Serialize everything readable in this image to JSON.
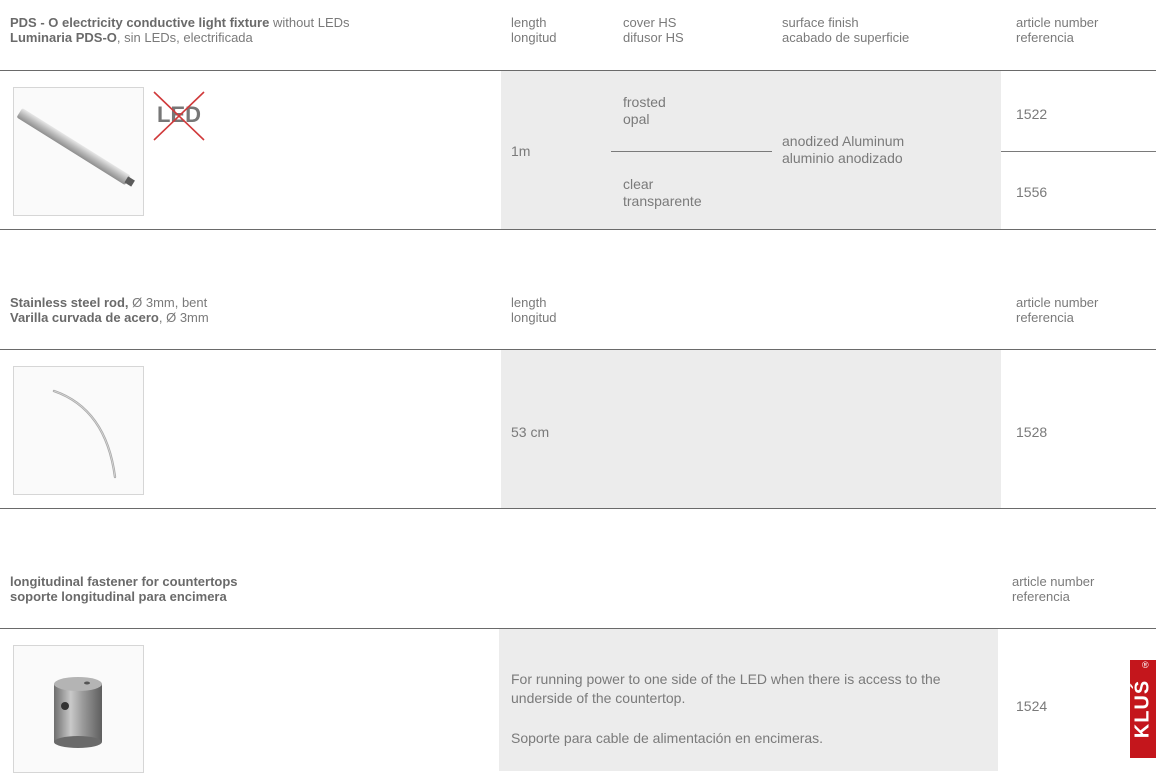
{
  "sec1": {
    "title_bold": "PDS - O  electricity conductive light fixture",
    "title_rest": " without LEDs",
    "subtitle_bold": "Luminaria PDS-O",
    "subtitle_rest": ", sin LEDs, electrificada",
    "col_length": [
      "length",
      "longitud"
    ],
    "col_cover": [
      "cover HS",
      "difusor HS"
    ],
    "col_finish": [
      "surface finish",
      "acabado de superficie"
    ],
    "col_article": [
      "article number",
      "referencia"
    ],
    "led_label": "LED",
    "length": "1m",
    "covers": [
      [
        "frosted",
        "opal"
      ],
      [
        "clear",
        "transparente"
      ]
    ],
    "finish": [
      "anodized Aluminum",
      "aluminio anodizado"
    ],
    "articles": [
      "1522",
      "1556"
    ]
  },
  "sec2": {
    "title_bold": "Stainless steel rod,",
    "title_rest": " Ø 3mm, bent",
    "subtitle_bold": "Varilla curvada de acero",
    "subtitle_rest": ", Ø 3mm",
    "col_length": [
      "length",
      "longitud"
    ],
    "col_article": [
      "article number",
      "referencia"
    ],
    "length": "53 cm",
    "article": "1528"
  },
  "sec3": {
    "title": "longitudinal fastener for countertops",
    "subtitle": "soporte longitudinal para encimera",
    "col_article": [
      "article number",
      "referencia"
    ],
    "desc_en": "For running power to one side of the LED when there is access to the underside of the countertop.",
    "desc_es": "Soporte para cable de alimentación en encimeras.",
    "article": "1524"
  },
  "logo": {
    "text": "KLUŚ",
    "reg": "®",
    "color": "#c4161c"
  }
}
